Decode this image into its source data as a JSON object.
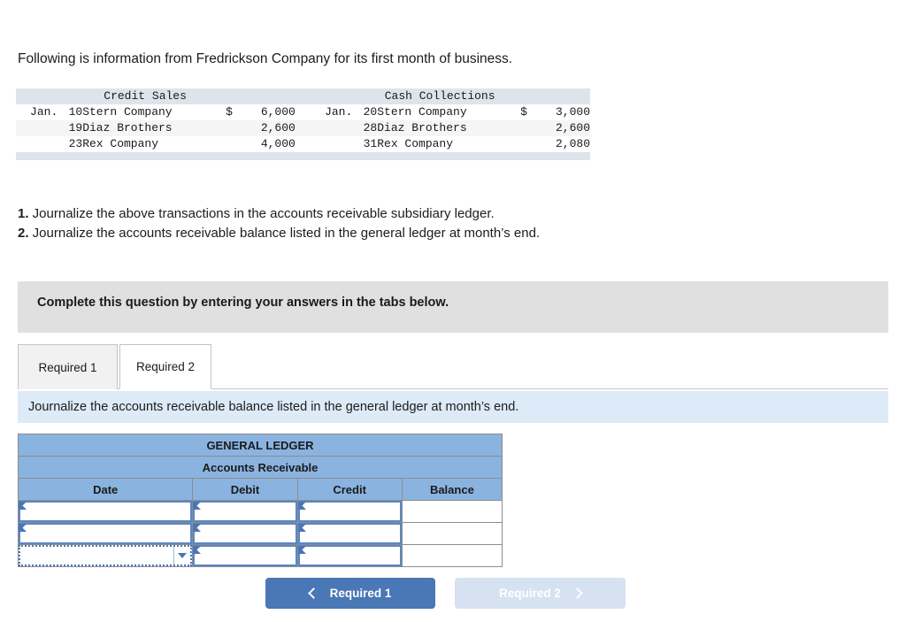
{
  "intro": "Following is information from Fredrickson Company for its first month of business.",
  "fact_table": {
    "headers": [
      "Credit Sales",
      "Cash Collections"
    ],
    "credit_sales": [
      {
        "month": "Jan.",
        "day": "10",
        "name": "Stern Company",
        "currency": "$",
        "amount": "6,000"
      },
      {
        "month": "",
        "day": "19",
        "name": "Diaz Brothers",
        "currency": "",
        "amount": "2,600"
      },
      {
        "month": "",
        "day": "23",
        "name": "Rex Company",
        "currency": "",
        "amount": "4,000"
      }
    ],
    "cash_collections": [
      {
        "month": "Jan.",
        "day": "20",
        "name": "Stern Company",
        "currency": "$",
        "amount": "3,000"
      },
      {
        "month": "",
        "day": "28",
        "name": "Diaz Brothers",
        "currency": "",
        "amount": "2,600"
      },
      {
        "month": "",
        "day": "31",
        "name": "Rex Company",
        "currency": "",
        "amount": "2,080"
      }
    ]
  },
  "requirements": [
    {
      "num": "1.",
      "text": " Journalize the above transactions in the accounts receivable subsidiary ledger."
    },
    {
      "num": "2.",
      "text": " Journalize the accounts receivable balance listed in the general ledger at month’s end."
    }
  ],
  "complete_panel": {
    "text": "Complete this question by entering your answers in the tabs below."
  },
  "tabs": [
    {
      "label": "Required 1",
      "active": false
    },
    {
      "label": "Required 2",
      "active": true
    }
  ],
  "banner": {
    "text": "Journalize the accounts receivable balance listed in the general ledger at month’s end."
  },
  "ledger": {
    "title": "GENERAL LEDGER",
    "subtitle": "Accounts Receivable",
    "columns": [
      "Date",
      "Debit",
      "Credit",
      "Balance"
    ],
    "rows": [
      {
        "date": "",
        "debit": "",
        "credit": "",
        "balance": "",
        "date_selected": false
      },
      {
        "date": "",
        "debit": "",
        "credit": "",
        "balance": "",
        "date_selected": false
      },
      {
        "date": "",
        "debit": "",
        "credit": "",
        "balance": "",
        "date_selected": true
      }
    ]
  },
  "nav": {
    "prev_label": "Required 1",
    "next_label": "Required 2"
  },
  "colors": {
    "ledger_header": "#8bb3e0",
    "banner": "#ddeaf7",
    "panel": "#e0e0e0",
    "primary_button": "#4a77b5",
    "disabled_button": "#d6e2f1",
    "cell_border": "#5b86c4"
  }
}
